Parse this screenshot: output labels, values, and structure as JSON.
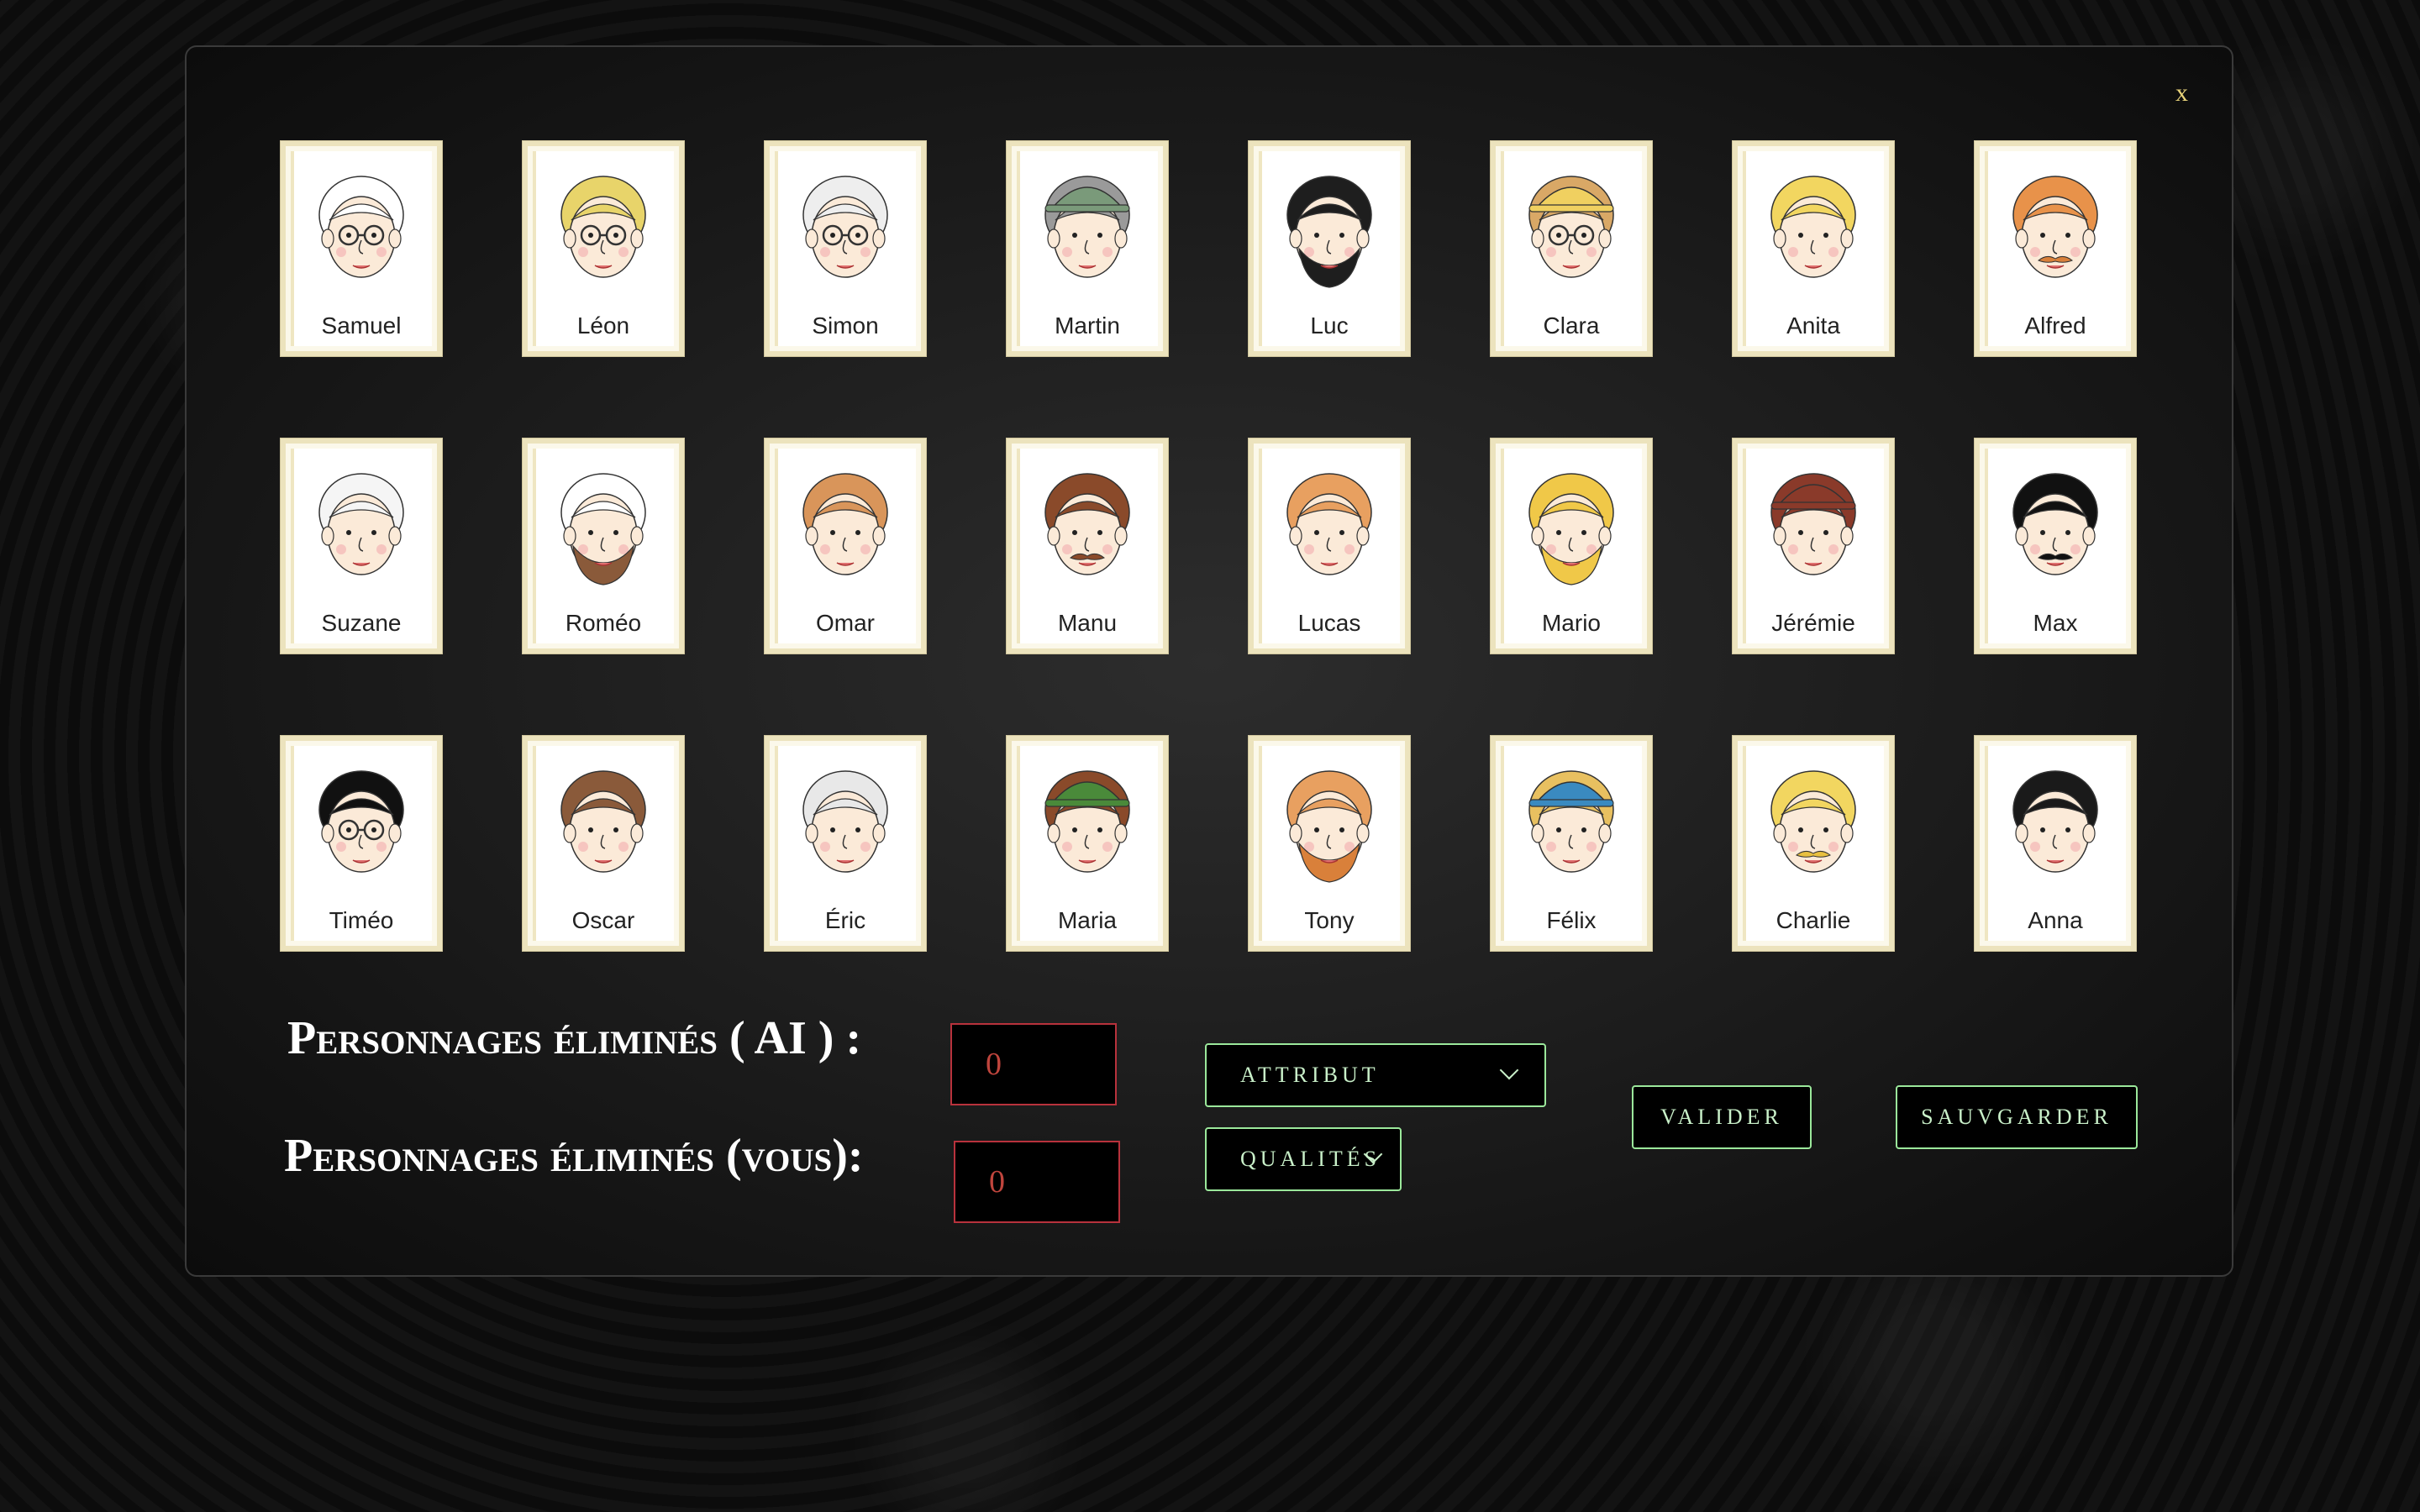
{
  "modal": {
    "close_label": "x"
  },
  "characters": [
    {
      "name": "Samuel",
      "hair": "#ffffff",
      "hat": "",
      "glasses": true,
      "beard": "",
      "mustache": ""
    },
    {
      "name": "Léon",
      "hair": "#e8d46a",
      "hat": "",
      "glasses": true,
      "beard": "",
      "mustache": ""
    },
    {
      "name": "Simon",
      "hair": "#eeeeee",
      "hat": "",
      "glasses": true,
      "beard": "",
      "mustache": ""
    },
    {
      "name": "Martin",
      "hair": "#9a9a9a",
      "hat": "#7a9a7a",
      "glasses": false,
      "beard": "",
      "mustache": ""
    },
    {
      "name": "Luc",
      "hair": "#1e1e1e",
      "hat": "",
      "glasses": false,
      "beard": "#1e1e1e",
      "mustache": ""
    },
    {
      "name": "Clara",
      "hair": "#d9a866",
      "hat": "#f0d060",
      "glasses": true,
      "beard": "",
      "mustache": ""
    },
    {
      "name": "Anita",
      "hair": "#f2d660",
      "hat": "",
      "glasses": false,
      "beard": "",
      "mustache": ""
    },
    {
      "name": "Alfred",
      "hair": "#e8924a",
      "hat": "",
      "glasses": false,
      "beard": "",
      "mustache": "#d9803a"
    },
    {
      "name": "Suzane",
      "hair": "#f5f5f5",
      "hat": "",
      "glasses": false,
      "beard": "",
      "mustache": ""
    },
    {
      "name": "Roméo",
      "hair": "#ffffff",
      "hat": "",
      "glasses": false,
      "beard": "#8a5a3a",
      "mustache": ""
    },
    {
      "name": "Omar",
      "hair": "#d9955a",
      "hat": "",
      "glasses": false,
      "beard": "",
      "mustache": ""
    },
    {
      "name": "Manu",
      "hair": "#8a4a2a",
      "hat": "",
      "glasses": false,
      "beard": "",
      "mustache": "#8a4a2a"
    },
    {
      "name": "Lucas",
      "hair": "#e8a060",
      "hat": "",
      "glasses": false,
      "beard": "",
      "mustache": ""
    },
    {
      "name": "Mario",
      "hair": "#f0c848",
      "hat": "",
      "glasses": false,
      "beard": "#f0c848",
      "mustache": ""
    },
    {
      "name": "Jérémie",
      "hair": "#8a3a2a",
      "hat": "#8a3a2a",
      "glasses": false,
      "beard": "",
      "mustache": ""
    },
    {
      "name": "Max",
      "hair": "#111111",
      "hat": "",
      "glasses": false,
      "beard": "",
      "mustache": "#111111"
    },
    {
      "name": "Timéo",
      "hair": "#111111",
      "hat": "",
      "glasses": true,
      "beard": "",
      "mustache": ""
    },
    {
      "name": "Oscar",
      "hair": "#8a5a3a",
      "hat": "",
      "glasses": false,
      "beard": "",
      "mustache": ""
    },
    {
      "name": "Éric",
      "hair": "#e8e8e8",
      "hat": "",
      "glasses": false,
      "beard": "",
      "mustache": ""
    },
    {
      "name": "Maria",
      "hair": "#8a4a2a",
      "hat": "#4a8a3a",
      "glasses": false,
      "beard": "",
      "mustache": ""
    },
    {
      "name": "Tony",
      "hair": "#e8a060",
      "hat": "",
      "glasses": false,
      "beard": "#d9803a",
      "mustache": ""
    },
    {
      "name": "Félix",
      "hair": "#e8c060",
      "hat": "#3a8ac0",
      "glasses": false,
      "beard": "",
      "mustache": ""
    },
    {
      "name": "Charlie",
      "hair": "#f2d660",
      "hat": "",
      "glasses": false,
      "beard": "",
      "mustache": "#e8c040"
    },
    {
      "name": "Anna",
      "hair": "#1a1a1a",
      "hat": "",
      "glasses": false,
      "beard": "",
      "mustache": ""
    }
  ],
  "counters": {
    "ai_label": "Personnages éliminés ( AI ) :",
    "ai_value": "0",
    "you_label": "Personnages éliminés (vous):",
    "you_value": "0"
  },
  "controls": {
    "attribut_label": "ATTRIBUT",
    "qualites_label": "QUALITÉS",
    "valider_label": "VALIDER",
    "sauvgarder_label": "SAUVGARDER"
  },
  "colors": {
    "accent_green": "#9be89b",
    "accent_red": "#b8323c",
    "close_gold": "#e8d37a"
  }
}
